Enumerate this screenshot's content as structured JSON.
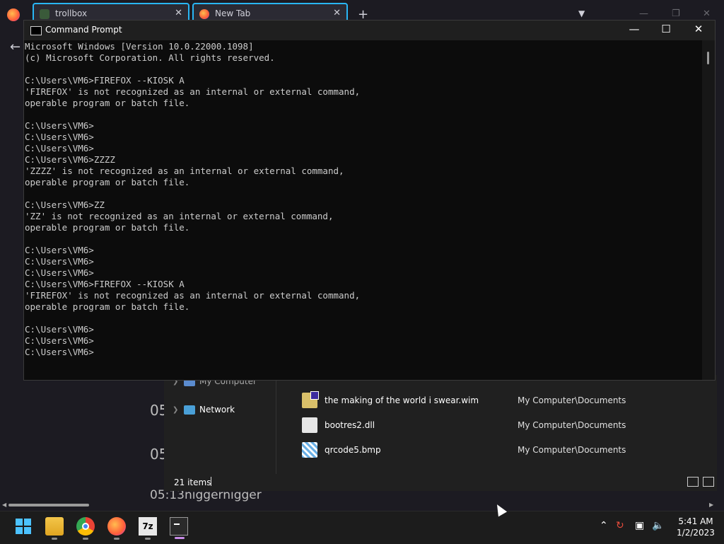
{
  "browser": {
    "tabs": [
      {
        "title": "trollbox"
      },
      {
        "title": "New Tab"
      }
    ],
    "close_glyph": "✕",
    "new_tab_glyph": "+"
  },
  "background": {
    "times": [
      "05",
      "05"
    ],
    "line": "05:13niggernigger"
  },
  "explorer": {
    "nav": [
      {
        "label": "My Computer"
      },
      {
        "label": "Network"
      }
    ],
    "files": [
      {
        "name": "the making of the world i swear.wim",
        "location": "My Computer\\Documents",
        "icon": "wim-file-icon"
      },
      {
        "name": "bootres2.dll",
        "location": "My Computer\\Documents",
        "icon": "dll-file-icon"
      },
      {
        "name": "qrcode5.bmp",
        "location": "My Computer\\Documents",
        "icon": "bmp-file-icon"
      }
    ],
    "status": {
      "item_count": "21 items"
    }
  },
  "cmd": {
    "title": "Command Prompt",
    "output": "Microsoft Windows [Version 10.0.22000.1098]\n(c) Microsoft Corporation. All rights reserved.\n\nC:\\Users\\VM6>FIREFOX --KIOSK A\n'FIREFOX' is not recognized as an internal or external command,\noperable program or batch file.\n\nC:\\Users\\VM6>\nC:\\Users\\VM6>\nC:\\Users\\VM6>\nC:\\Users\\VM6>ZZZZ\n'ZZZZ' is not recognized as an internal or external command,\noperable program or batch file.\n\nC:\\Users\\VM6>ZZ\n'ZZ' is not recognized as an internal or external command,\noperable program or batch file.\n\nC:\\Users\\VM6>\nC:\\Users\\VM6>\nC:\\Users\\VM6>\nC:\\Users\\VM6>FIREFOX --KIOSK A\n'FIREFOX' is not recognized as an internal or external command,\noperable program or batch file.\n\nC:\\Users\\VM6>\nC:\\Users\\VM6>\nC:\\Users\\VM6>"
  },
  "taskbar": {
    "apps": [
      "windows-start-icon",
      "file-explorer-icon",
      "chrome-icon",
      "firefox-icon",
      "7zip-icon",
      "terminal-icon"
    ],
    "zip_label": "7z",
    "clock": {
      "time": "5:41 AM",
      "date": "1/2/2023"
    }
  },
  "colors": {
    "accent": "#29b6f6",
    "taskbar_active": "#c88be8",
    "terminal_text": "#cccccc"
  }
}
